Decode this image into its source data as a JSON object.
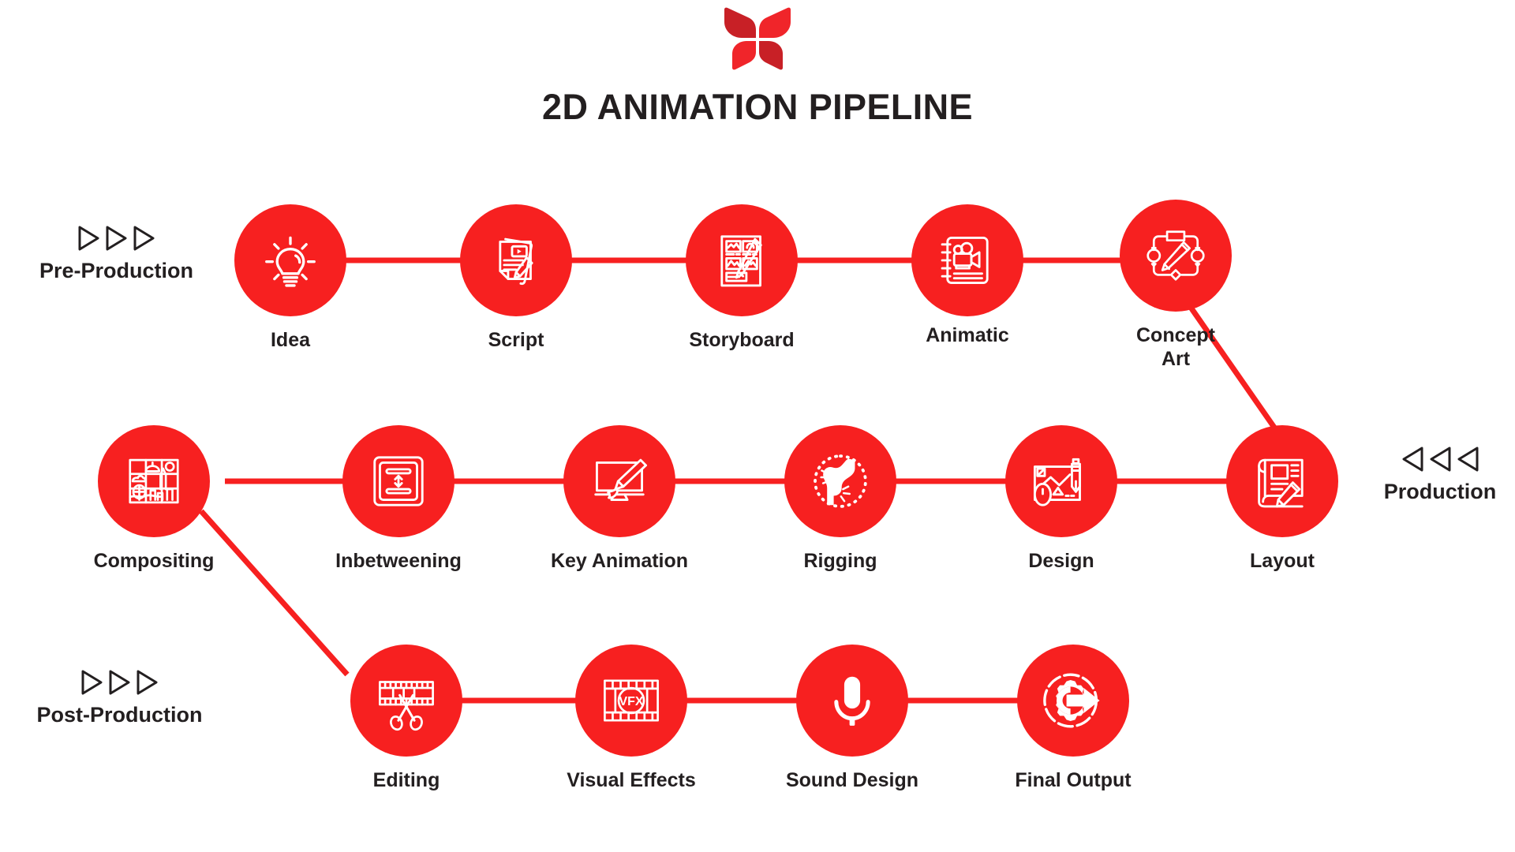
{
  "header": {
    "logo_name": "butterfly-logo",
    "logo_color": "#e32128",
    "title": "2D ANIMATION PIPELINE"
  },
  "theme": {
    "accent": "#f72020",
    "text": "#231f20",
    "background": "#ffffff"
  },
  "phases": [
    {
      "id": "pre-production",
      "label": "Pre-Production",
      "arrow_direction": "right",
      "arrow_count": 3
    },
    {
      "id": "production",
      "label": "Production",
      "arrow_direction": "left",
      "arrow_count": 3
    },
    {
      "id": "post-production",
      "label": "Post-Production",
      "arrow_direction": "right",
      "arrow_count": 3
    }
  ],
  "rows": [
    {
      "id": "row-pre-production",
      "nodes": [
        {
          "id": "idea",
          "label": "Idea",
          "icon": "lightbulb-icon"
        },
        {
          "id": "script",
          "label": "Script",
          "icon": "script-document-pencil-icon"
        },
        {
          "id": "storyboard",
          "label": "Storyboard",
          "icon": "storyboard-panels-pencil-icon"
        },
        {
          "id": "animatic",
          "label": "Animatic",
          "icon": "notebook-movie-camera-icon"
        },
        {
          "id": "concept-art",
          "label": "Concept\nArt",
          "icon": "node-frame-pencil-icon"
        }
      ]
    },
    {
      "id": "row-production",
      "nodes": [
        {
          "id": "compositing",
          "label": "Compositing",
          "icon": "layered-scene-grid-icon"
        },
        {
          "id": "inbetweening",
          "label": "Inbetweening",
          "icon": "vertical-double-arrow-frame-icon"
        },
        {
          "id": "key-animation",
          "label": "Key Animation",
          "icon": "monitor-paintbrush-icon"
        },
        {
          "id": "rigging",
          "label": "Rigging",
          "icon": "bone-joint-icon"
        },
        {
          "id": "design",
          "label": "Design",
          "icon": "tablet-mouse-pencil-icon"
        },
        {
          "id": "layout",
          "label": "Layout",
          "icon": "blueprint-scroll-pencil-icon"
        }
      ]
    },
    {
      "id": "row-post-production",
      "nodes": [
        {
          "id": "editing",
          "label": "Editing",
          "icon": "film-strip-scissors-icon"
        },
        {
          "id": "visual-effects",
          "label": "Visual Effects",
          "icon": "film-strip-vfx-icon",
          "inner_text": "VFX"
        },
        {
          "id": "sound-design",
          "label": "Sound Design",
          "icon": "microphone-icon"
        },
        {
          "id": "final-output",
          "label": "Final Output",
          "icon": "gear-arrow-export-icon"
        }
      ]
    }
  ]
}
